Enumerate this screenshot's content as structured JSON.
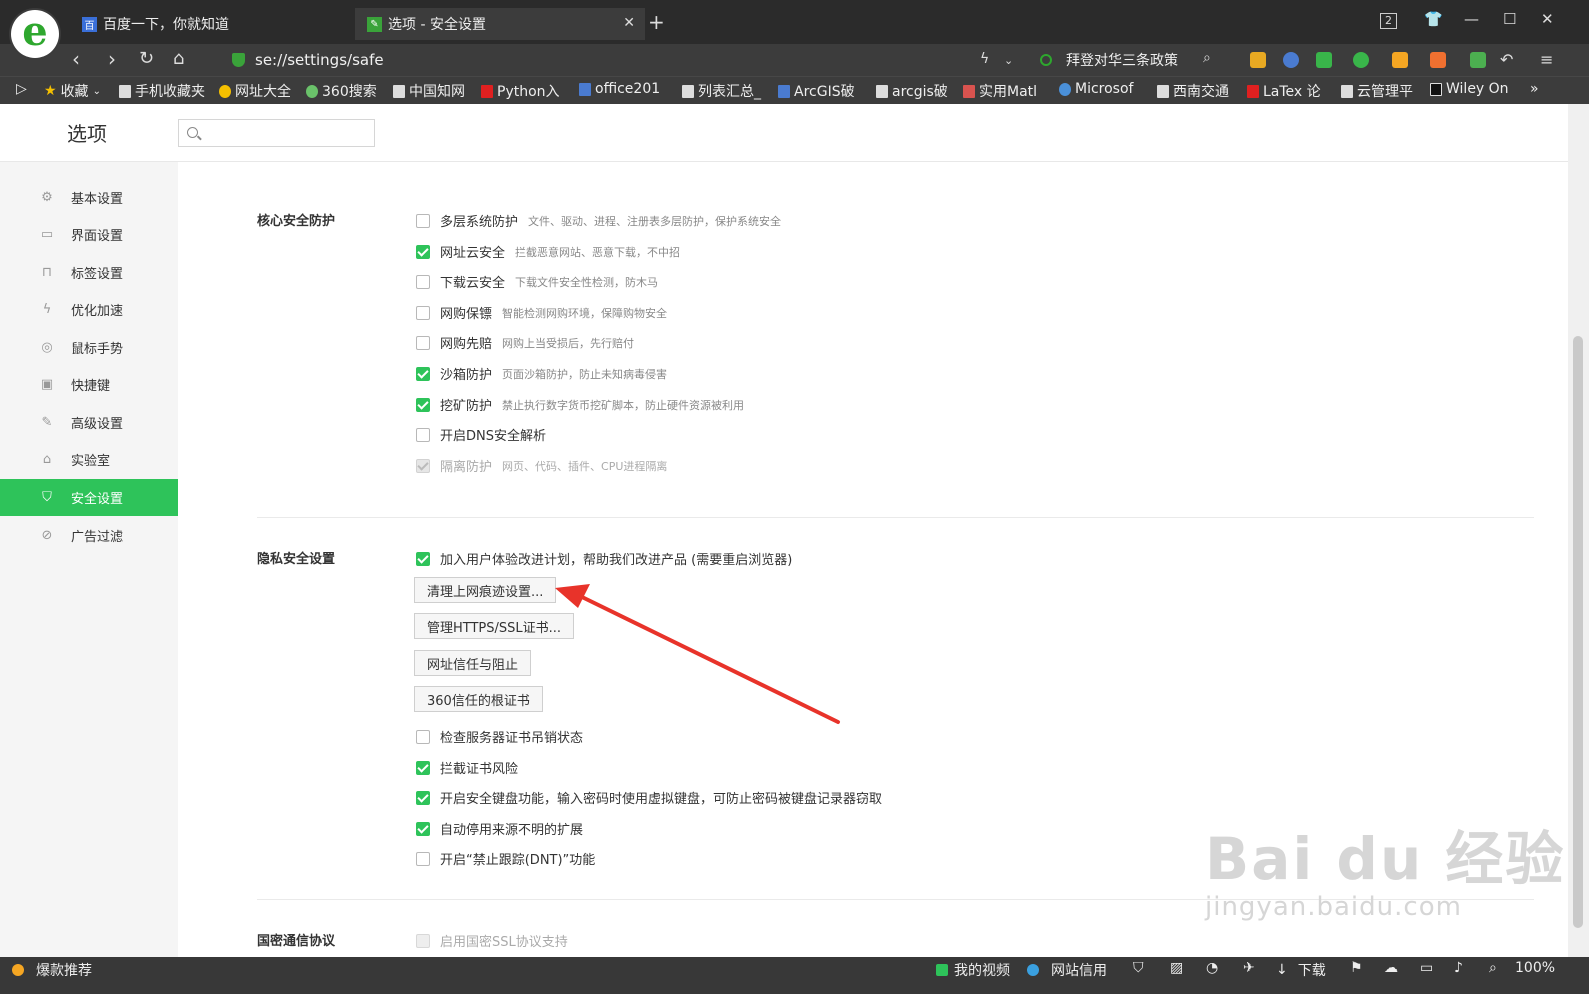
{
  "browser": {
    "tabs": [
      {
        "title": "百度一下，你就知道"
      },
      {
        "title": "选项 - 安全设置"
      }
    ],
    "url": "se://settings/safe",
    "search_hint": "拜登对华三条政策",
    "tab_count_badge": "2",
    "bookmarks": [
      "收藏",
      "手机收藏夹",
      "网址大全",
      "360搜索",
      "中国知网",
      "Python入",
      "office201",
      "列表汇总_",
      "ArcGIS破",
      "arcgis破",
      "实用Matl",
      "Microsof",
      "西南交通",
      "LaTex 论",
      "云管理平",
      "Wiley On"
    ],
    "bookmarks_more": "»"
  },
  "settings": {
    "title": "选项",
    "search_placeholder": "",
    "nav": [
      {
        "label": "基本设置",
        "icon": "gear-icon"
      },
      {
        "label": "界面设置",
        "icon": "window-icon"
      },
      {
        "label": "标签设置",
        "icon": "tab-icon"
      },
      {
        "label": "优化加速",
        "icon": "lightning-icon"
      },
      {
        "label": "鼠标手势",
        "icon": "mouse-icon"
      },
      {
        "label": "快捷键",
        "icon": "keyboard-icon"
      },
      {
        "label": "高级设置",
        "icon": "wrench-icon"
      },
      {
        "label": "实验室",
        "icon": "flask-icon"
      },
      {
        "label": "安全设置",
        "icon": "shield-icon",
        "active": true
      },
      {
        "label": "广告过滤",
        "icon": "block-icon"
      }
    ],
    "core_section": {
      "label": "核心安全防护",
      "options": [
        {
          "label": "多层系统防护",
          "desc": "文件、驱动、进程、注册表多层防护，保护系统安全",
          "checked": false
        },
        {
          "label": "网址云安全",
          "desc": "拦截恶意网站、恶意下载，不中招",
          "checked": true
        },
        {
          "label": "下载云安全",
          "desc": "下载文件安全性检测，防木马",
          "checked": false
        },
        {
          "label": "网购保镖",
          "desc": "智能检测网购环境，保障购物安全",
          "checked": false
        },
        {
          "label": "网购先赔",
          "desc": "网购上当受损后，先行赔付",
          "checked": false
        },
        {
          "label": "沙箱防护",
          "desc": "页面沙箱防护，防止未知病毒侵害",
          "checked": true
        },
        {
          "label": "挖矿防护",
          "desc": "禁止执行数字货币挖矿脚本，防止硬件资源被利用",
          "checked": true
        },
        {
          "label": "开启DNS安全解析",
          "desc": "",
          "checked": false
        },
        {
          "label": "隔离防护",
          "desc": "网页、代码、插件、CPU进程隔离",
          "checked": true,
          "disabled": true
        }
      ]
    },
    "privacy_section": {
      "label": "隐私安全设置",
      "top_option": {
        "label": "加入用户体验改进计划，帮助我们改进产品  (需要重启浏览器)",
        "checked": true
      },
      "buttons": [
        "清理上网痕迹设置...",
        "管理HTTPS/SSL证书...",
        "网址信任与阻止",
        "360信任的根证书"
      ],
      "options": [
        {
          "label": "检查服务器证书吊销状态",
          "checked": false
        },
        {
          "label": "拦截证书风险",
          "checked": true
        },
        {
          "label": "开启安全键盘功能，输入密码时使用虚拟键盘，可防止密码被键盘记录器窃取",
          "checked": true
        },
        {
          "label": "自动停用来源不明的扩展",
          "checked": true
        },
        {
          "label": "开启“禁止跟踪(DNT)”功能",
          "checked": false
        }
      ]
    },
    "crypto_section": {
      "label": "国密通信协议",
      "option": {
        "label": "启用国密SSL协议支持",
        "checked": false,
        "disabled": true
      }
    }
  },
  "watermark": {
    "line1": "Bai du 经验",
    "line2": "jingyan.baidu.com"
  },
  "statusbar": {
    "left": "爆款推荐",
    "my_video": "我的视频",
    "site_credit": "网站信用",
    "download": "下载",
    "zoom": "100%"
  }
}
